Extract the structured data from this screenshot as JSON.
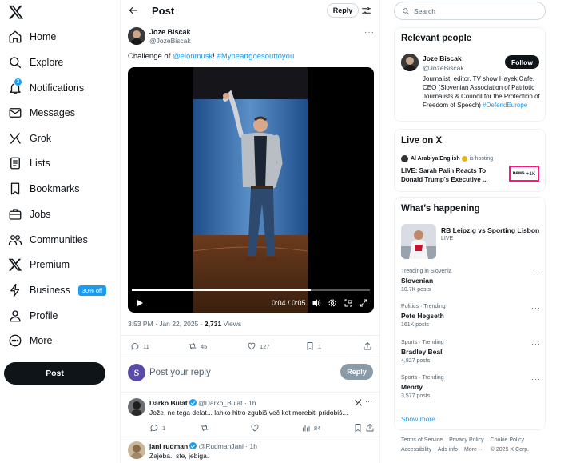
{
  "nav": {
    "items": [
      {
        "label": "Home",
        "icon": "home-icon"
      },
      {
        "label": "Explore",
        "icon": "search-icon"
      },
      {
        "label": "Notifications",
        "icon": "bell-icon",
        "badge": "3"
      },
      {
        "label": "Messages",
        "icon": "envelope-icon"
      },
      {
        "label": "Grok",
        "icon": "grok-icon"
      },
      {
        "label": "Lists",
        "icon": "list-icon"
      },
      {
        "label": "Bookmarks",
        "icon": "bookmark-icon"
      },
      {
        "label": "Jobs",
        "icon": "briefcase-icon"
      },
      {
        "label": "Communities",
        "icon": "people-icon"
      },
      {
        "label": "Premium",
        "icon": "x-logo-icon"
      },
      {
        "label": "Business",
        "icon": "lightning-icon",
        "badge": "30% off"
      },
      {
        "label": "Profile",
        "icon": "user-icon"
      },
      {
        "label": "More",
        "icon": "more-circle-icon"
      }
    ],
    "post_button": "Post"
  },
  "header": {
    "title": "Post",
    "reply_label": "Reply"
  },
  "post": {
    "author_name": "Joze Biscak",
    "author_handle": "@JozeBiscak",
    "text_prefix": "Challenge of ",
    "mention": "@elonmusk",
    "text_mid": "! ",
    "hashtag": "#Myheartgoesouttoyou",
    "video": {
      "time": "0:04 / 0:05",
      "progress": 0.75
    },
    "timestamp": "3:53 PM · Jan 22, 2025 · ",
    "views_count": "2,731",
    "views_label": " Views",
    "stats": {
      "replies": "11",
      "reposts": "45",
      "likes": "127",
      "bookmarks": "1"
    }
  },
  "composer": {
    "placeholder": "Post your reply",
    "reply_button": "Reply"
  },
  "replies": [
    {
      "name": "Darko Bulat",
      "handle": "@Darko_Bulat",
      "time": "· 1h",
      "text": "Jože, ne tega delat... lahko hitro zgubiš več kot morebiti pridobiš...",
      "stats": {
        "replies": "1",
        "reposts": "",
        "likes": "",
        "views": "84"
      }
    },
    {
      "name": "jani rudman",
      "handle": "@RudmanJani",
      "time": "· 1h",
      "text": "Zajeba.. ste, jebiga."
    }
  ],
  "search": {
    "placeholder": "Search"
  },
  "relevant": {
    "title": "Relevant people",
    "name": "Joze Biscak",
    "handle": "@JozeBiscak",
    "follow_label": "Follow",
    "bio": "Journalist, editor. TV show Hayek Cafe. CEO (Slovenian Association of Patriotic Journalists & Council for the Protection of Freedom of Speech)",
    "bio_hashtag": "#DefendEurope"
  },
  "live": {
    "title": "Live on X",
    "host": "Al Arabiya English",
    "hosting_label": "is hosting",
    "headline": "LIVE: Sarah Palin Reacts To Donald Trump's Executive ...",
    "thumb_brand": "news",
    "listeners": "+1K"
  },
  "happening": {
    "title": "What’s happening",
    "event": "RB Leipzig vs Sporting Lisbon",
    "event_status": "LIVE",
    "trends": [
      {
        "context": "Trending in Slovenia",
        "name": "Slovenian",
        "posts": "10.7K posts"
      },
      {
        "context": "Politics · Trending",
        "name": "Pete Hegseth",
        "posts": "161K posts"
      },
      {
        "context": "Sports · Trending",
        "name": "Bradley Beal",
        "posts": "4,827 posts"
      },
      {
        "context": "Sports · Trending",
        "name": "Mendy",
        "posts": "3,577 posts"
      }
    ],
    "show_more": "Show more"
  },
  "footer": {
    "links": [
      "Terms of Service",
      "Privacy Policy",
      "Cookie Policy",
      "Accessibility",
      "Ads info",
      "More ···",
      "© 2025 X Corp."
    ]
  },
  "colors": {
    "accent": "#1d9bf0",
    "text": "#0f1419",
    "muted": "#536471",
    "live_border": "#f91880"
  }
}
